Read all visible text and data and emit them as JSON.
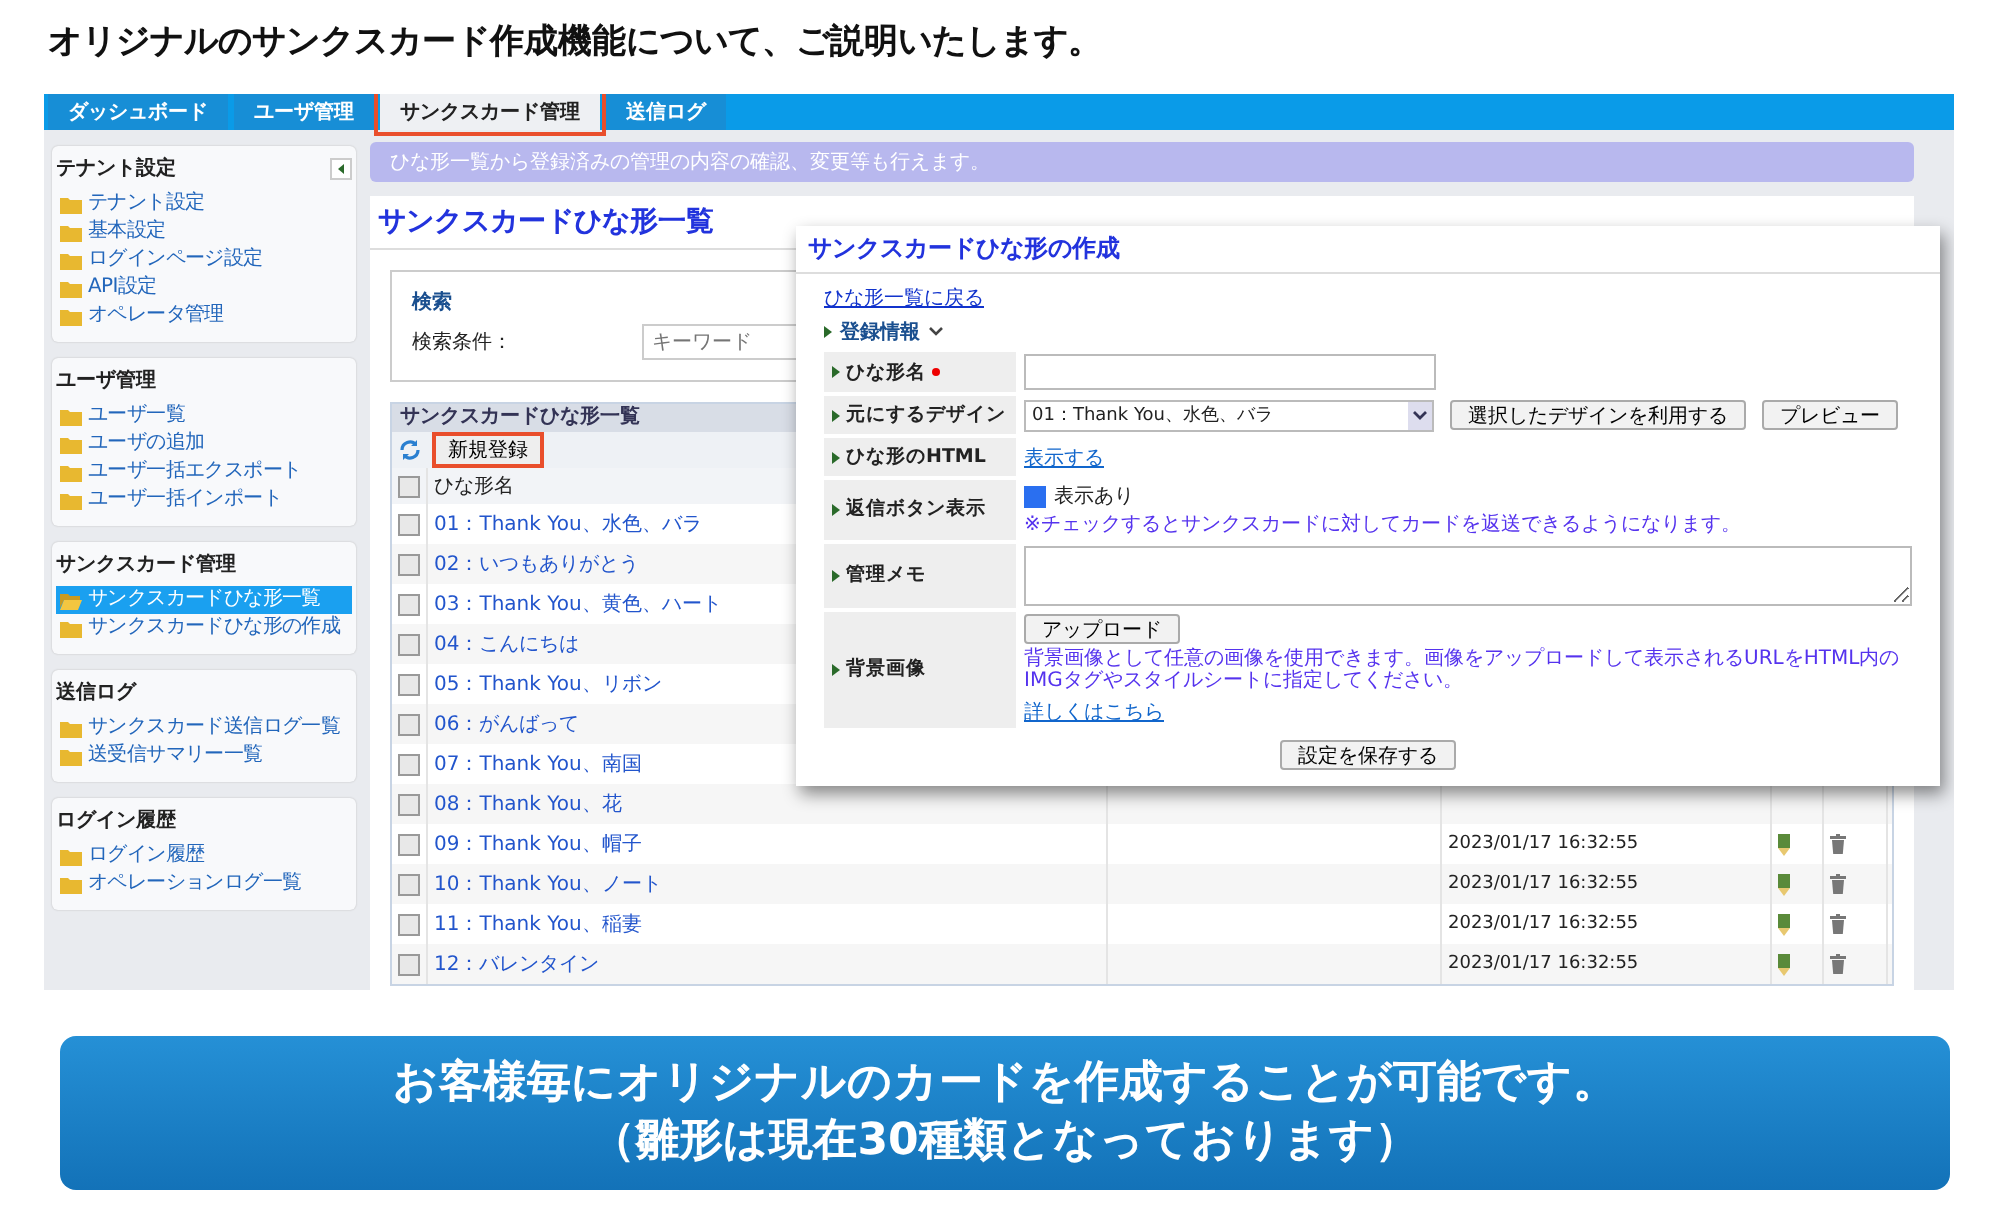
{
  "heading": "オリジナルのサンクスカード作成機能について、ご説明いたします。",
  "tabs": [
    {
      "label": "ダッシュボード",
      "selected": false,
      "highlighted": false
    },
    {
      "label": "ユーザ管理",
      "selected": false,
      "highlighted": false
    },
    {
      "label": "サンクスカード管理",
      "selected": true,
      "highlighted": true
    },
    {
      "label": "送信ログ",
      "selected": false,
      "highlighted": false
    }
  ],
  "sidebar": {
    "sections": [
      {
        "title": "テナント設定",
        "collapsible": true,
        "items": [
          {
            "label": "テナント設定",
            "selected": false
          },
          {
            "label": "基本設定",
            "selected": false
          },
          {
            "label": "ログインページ設定",
            "selected": false
          },
          {
            "label": "API設定",
            "selected": false
          },
          {
            "label": "オペレータ管理",
            "selected": false
          }
        ]
      },
      {
        "title": "ユーザ管理",
        "collapsible": false,
        "items": [
          {
            "label": "ユーザ一覧",
            "selected": false
          },
          {
            "label": "ユーザの追加",
            "selected": false
          },
          {
            "label": "ユーザ一括エクスポート",
            "selected": false
          },
          {
            "label": "ユーザ一括インポート",
            "selected": false
          }
        ]
      },
      {
        "title": "サンクスカード管理",
        "collapsible": false,
        "items": [
          {
            "label": "サンクスカードひな形一覧",
            "selected": true
          },
          {
            "label": "サンクスカードひな形の作成",
            "selected": false
          }
        ]
      },
      {
        "title": "送信ログ",
        "collapsible": false,
        "items": [
          {
            "label": "サンクスカード送信ログ一覧",
            "selected": false
          },
          {
            "label": "送受信サマリー一覧",
            "selected": false
          }
        ]
      },
      {
        "title": "ログイン履歴",
        "collapsible": false,
        "items": [
          {
            "label": "ログイン履歴",
            "selected": false
          },
          {
            "label": "オペレーションログ一覧",
            "selected": false
          }
        ]
      }
    ]
  },
  "info_bar": "ひな形一覧から登録済みの管理の内容の確認、変更等も行えます。",
  "page_title": "サンクスカードひな形一覧",
  "search": {
    "title": "検索",
    "label": "検索条件：",
    "placeholder": "キーワード"
  },
  "grid": {
    "title": "サンクスカードひな形一覧",
    "new_button": {
      "label": "新規登録",
      "highlighted": true
    },
    "header": {
      "name": "ひな形名",
      "checked": false
    },
    "rows": [
      {
        "name": "01：Thank You、水色、バラ",
        "checked": false
      },
      {
        "name": "02：いつもありがとう",
        "checked": false
      },
      {
        "name": "03：Thank You、黄色、ハート",
        "checked": false
      },
      {
        "name": "04：こんにちは",
        "checked": false
      },
      {
        "name": "05：Thank You、リボン",
        "checked": false
      },
      {
        "name": "06：がんばって",
        "checked": false
      },
      {
        "name": "07：Thank You、南国",
        "checked": false
      },
      {
        "name": "08：Thank You、花",
        "checked": false
      },
      {
        "name": "09：Thank You、帽子",
        "checked": false,
        "date": "2023/01/17 16:32:55"
      },
      {
        "name": "10：Thank You、ノート",
        "checked": false,
        "date": "2023/01/17 16:32:55"
      },
      {
        "name": "11：Thank You、稲妻",
        "checked": false,
        "date": "2023/01/17 16:32:55"
      },
      {
        "name": "12：バレンタイン",
        "checked": false,
        "date": "2023/01/17 16:32:55"
      }
    ]
  },
  "modal": {
    "title": "サンクスカードひな形の作成",
    "back_link": "ひな形一覧に戻る",
    "section": "登録情報",
    "fields": [
      {
        "kind": "text",
        "label": "ひな形名",
        "required": true
      },
      {
        "kind": "select",
        "label": "元にするデザイン",
        "required": false,
        "value": "01：Thank You、水色、バラ",
        "buttons": [
          "選択したデザインを利用する",
          "プレビュー"
        ]
      },
      {
        "kind": "link",
        "label": "ひな形のHTML",
        "required": false,
        "link": "表示する"
      },
      {
        "kind": "checkbox",
        "label": "返信ボタン表示",
        "required": false,
        "option": "表示あり",
        "checked": true,
        "note": "※チェックするとサンクスカードに対してカードを返送できるようになります。"
      },
      {
        "kind": "textarea",
        "label": "管理メモ",
        "required": false
      },
      {
        "kind": "upload",
        "label": "背景画像",
        "required": false,
        "button": "アップロード",
        "note": "背景画像として任意の画像を使用できます。画像をアップロードして表示されるURLをHTML内のIMGタグやスタイルシートに指定してください。",
        "link": "詳しくはこちら"
      }
    ],
    "save_button": "設定を保存する"
  },
  "banner": {
    "lines": [
      "お客様毎にオリジナルのカードを作成することが可能です。",
      "（雛形は現在30種類となっております）"
    ]
  }
}
